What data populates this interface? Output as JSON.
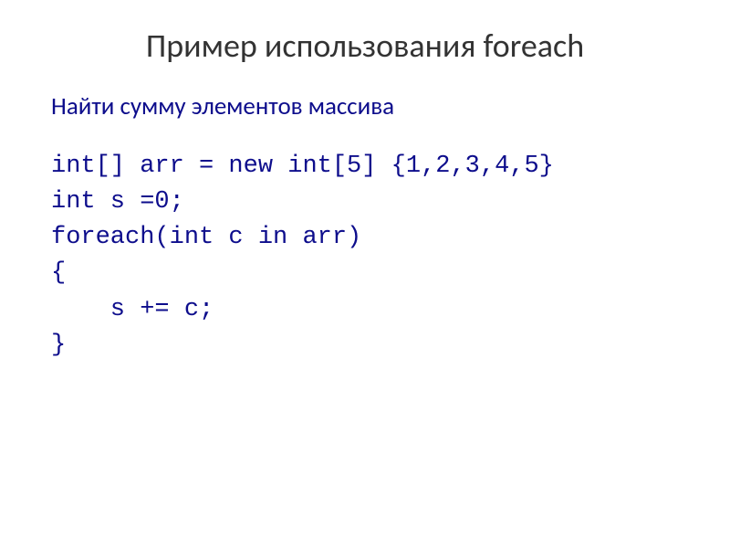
{
  "slide": {
    "title": "Пример использования foreach",
    "subtitle": "Найти сумму элементов массива",
    "code_lines": {
      "l1": "int[] arr = new int[5] {1,2,3,4,5}",
      "l2": "int s =0;",
      "l3": "foreach(int c in arr)",
      "l4": "{",
      "l5": "    s += c;",
      "l6": "}"
    }
  }
}
